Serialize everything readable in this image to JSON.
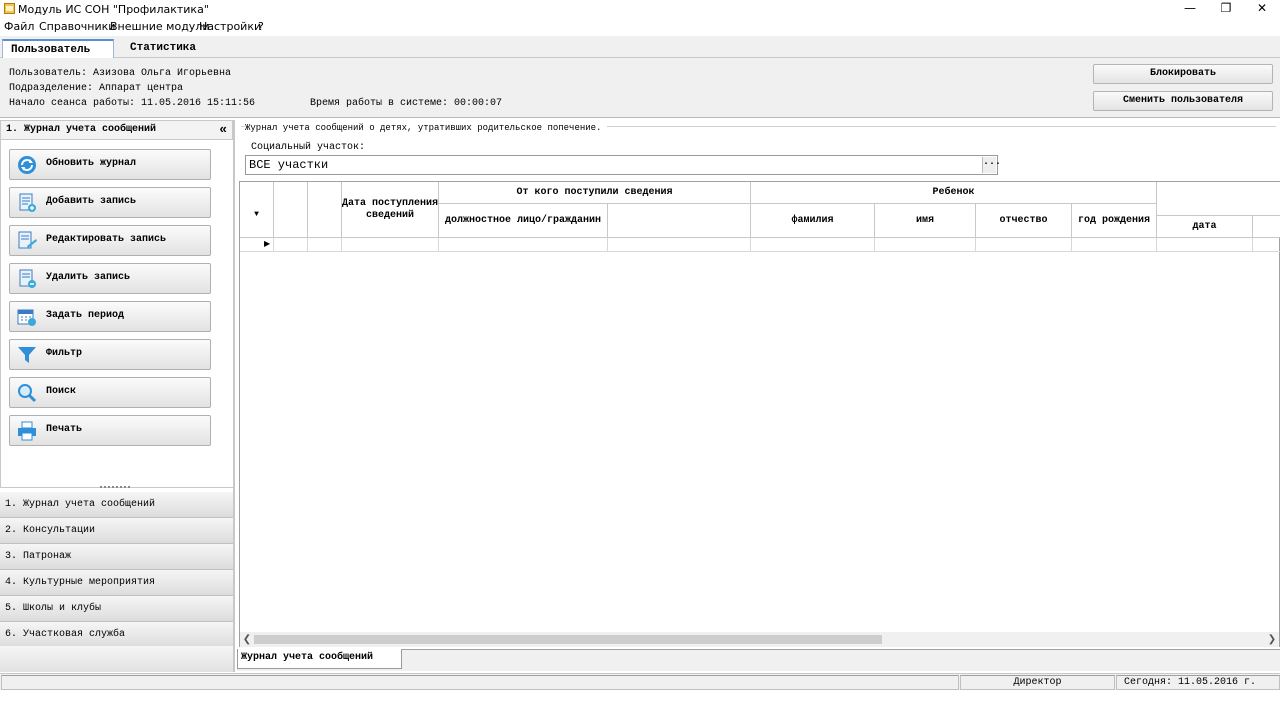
{
  "window": {
    "title": "Модуль ИС СОН \"Профилактика\"",
    "minimize": "—",
    "restore": "❐",
    "close": "✕"
  },
  "menu": {
    "file": "Файл",
    "refs": "Справочники",
    "modules": "Внешние модули",
    "settings": "Настройки",
    "help": "?"
  },
  "top_tabs": {
    "user": "Пользователь",
    "stats": "Статистика"
  },
  "user_panel": {
    "user_line": "Пользователь: Азизова Ольга Игорьевна",
    "dept_line": "Подразделение: Аппарат центра",
    "session_line": "Начало сеанса работы: 11.05.2016 15:11:56",
    "worktime_line": "Время работы в системе: 00:00:07",
    "block_button": "Блокировать",
    "switch_user_button": "Сменить пользователя"
  },
  "left_panel": {
    "header": "1. Журнал учета сообщений",
    "collapse": "«",
    "actions": {
      "refresh": "Обновить журнал",
      "add": "Добавить запись",
      "edit": "Редактировать запись",
      "delete": "Удалить запись",
      "period": "Задать период",
      "filter": "Фильтр",
      "search": "Поиск",
      "print": "Печать"
    },
    "nav": {
      "n1": "1. Журнал учета сообщений",
      "n2": "2. Консультации",
      "n3": "3. Патронаж",
      "n4": "4. Культурные мероприятия",
      "n5": "5. Школы и клубы",
      "n6": "6. Участковая служба"
    }
  },
  "main": {
    "group_title": "Журнал учета сообщений о детях, утративших родительское попечение.",
    "social_label": "Социальный участок:",
    "social_value": "ВСЕ участки",
    "social_dots": "...",
    "columns": {
      "date_received": "Дата поступления сведений",
      "from_whom": "От кого поступили сведения",
      "official": "должностное лицо/гражданин",
      "child": "Ребенок",
      "surname": "фамилия",
      "name": "имя",
      "patronymic": "отчество",
      "birth_year": "год рождения",
      "date": "дата"
    },
    "bottom_tab": "Журнал учета сообщений"
  },
  "status": {
    "role": "Директор",
    "today": "Сегодня: 11.05.2016 г."
  },
  "colors": {
    "accent": "#5a8fd0",
    "icon_blue": "#2f8fd8",
    "icon_teal": "#3ba9d9"
  }
}
